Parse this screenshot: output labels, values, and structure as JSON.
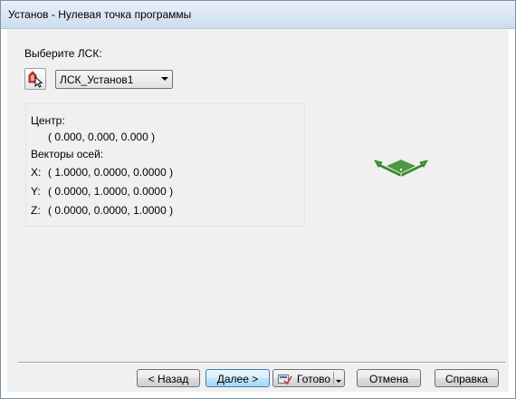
{
  "window": {
    "title": "Установ - Нулевая точка программы"
  },
  "form": {
    "choose_label": "Выберите ЛСК:",
    "ucs_button_icon": "pick-ucs-icon",
    "ucs_selected": "ЛСК_Установ1"
  },
  "info": {
    "center_label": "Центр:",
    "center_value": "( 0.000, 0.000, 0.000 )",
    "axes_label": "Векторы осей:",
    "x_label": "X:",
    "x_value": "( 1.0000, 0.0000, 0.0000 )",
    "y_label": "Y:",
    "y_value": "( 0.0000, 1.0000, 0.0000 )",
    "z_label": "Z:",
    "z_value": "( 0.0000, 0.0000, 1.0000 )"
  },
  "preview": {
    "icon": "ucs-axes-icon",
    "color": "#3fa534"
  },
  "buttons": {
    "back": "< Назад",
    "next": "Далее >",
    "finish": "Готово",
    "cancel": "Отмена",
    "help": "Справка"
  }
}
